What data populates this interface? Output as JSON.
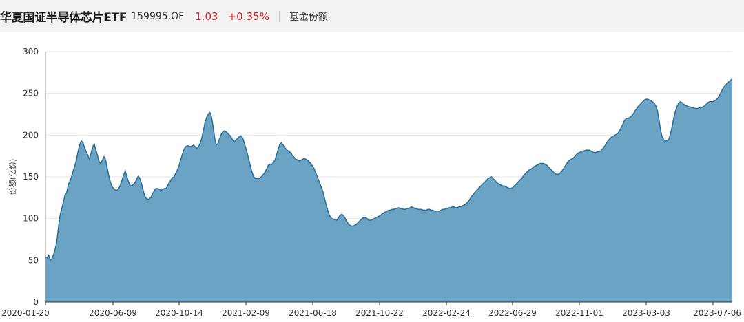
{
  "header": {
    "fund_name": "华夏国证半导体芯片ETF",
    "fund_code": "159995.OF",
    "price": "1.03",
    "change": "+0.35%",
    "metric_label": "基金份额"
  },
  "colors": {
    "area_fill": "#6aa3c4",
    "area_line": "#2d6f96",
    "up": "#d9262e",
    "grid": "#e6e6e6"
  },
  "chart_data": {
    "type": "area",
    "title": "",
    "xlabel": "",
    "ylabel": "份额(亿份)",
    "ylim": [
      0,
      300
    ],
    "yticks": [
      0,
      50,
      100,
      150,
      200,
      250,
      300
    ],
    "grid": true,
    "x_tick_labels": [
      "2020-01-20",
      "2020-06-09",
      "2020-10-14",
      "2021-02-09",
      "2021-06-18",
      "2021-10-22",
      "2022-02-24",
      "2022-06-29",
      "2022-11-01",
      "2023-03-03",
      "2023-07-06"
    ],
    "series": [
      {
        "values": [
          54,
          53,
          56,
          50,
          52,
          57,
          64,
          72,
          90,
          104,
          112,
          120,
          128,
          131,
          140,
          145,
          150,
          157,
          163,
          170,
          180,
          188,
          193,
          191,
          185,
          180,
          176,
          171,
          178,
          186,
          189,
          182,
          175,
          168,
          166,
          170,
          174,
          170,
          160,
          150,
          143,
          138,
          136,
          134,
          134,
          136,
          140,
          146,
          152,
          157,
          150,
          144,
          140,
          139,
          141,
          143,
          147,
          151,
          148,
          142,
          134,
          127,
          124,
          123,
          124,
          126,
          130,
          134,
          136,
          136,
          135,
          134,
          135,
          136,
          136,
          139,
          143,
          146,
          149,
          150,
          154,
          158,
          163,
          170,
          176,
          182,
          186,
          187,
          187,
          186,
          187,
          188,
          186,
          184,
          186,
          190,
          196,
          205,
          215,
          221,
          225,
          227,
          222,
          210,
          196,
          188,
          190,
          196,
          201,
          204,
          205,
          204,
          202,
          200,
          198,
          194,
          192,
          194,
          196,
          198,
          199,
          197,
          192,
          185,
          178,
          170,
          162,
          155,
          150,
          148,
          148,
          148,
          149,
          151,
          153,
          156,
          160,
          164,
          165,
          165,
          167,
          170,
          176,
          183,
          189,
          191,
          188,
          185,
          183,
          181,
          180,
          178,
          175,
          173,
          171,
          170,
          169,
          170,
          171,
          172,
          171,
          170,
          168,
          166,
          163,
          160,
          155,
          150,
          145,
          140,
          135,
          128,
          120,
          113,
          106,
          102,
          100,
          99,
          99,
          98,
          101,
          104,
          105,
          104,
          101,
          97,
          94,
          92,
          91,
          91,
          92,
          93,
          95,
          97,
          99,
          101,
          101,
          101,
          99,
          98,
          98,
          99,
          100,
          101,
          102,
          103,
          104,
          106,
          107,
          108,
          109,
          110,
          110,
          111,
          111,
          112,
          112,
          113,
          112,
          112,
          111,
          111,
          112,
          112,
          113,
          114,
          113,
          112,
          112,
          111,
          111,
          111,
          110,
          110,
          110,
          111,
          111,
          110,
          110,
          109,
          109,
          109,
          109,
          110,
          111,
          111,
          112,
          112,
          113,
          113,
          114,
          114,
          113,
          113,
          114,
          114,
          115,
          116,
          117,
          119,
          121,
          124,
          127,
          129,
          132,
          134,
          136,
          138,
          140,
          142,
          144,
          146,
          148,
          149,
          150,
          148,
          146,
          144,
          142,
          141,
          140,
          139,
          139,
          138,
          137,
          136,
          136,
          137,
          139,
          141,
          143,
          145,
          147,
          149,
          152,
          154,
          156,
          158,
          159,
          160,
          162,
          163,
          164,
          165,
          166,
          166,
          166,
          165,
          164,
          162,
          160,
          158,
          156,
          154,
          153,
          153,
          154,
          156,
          159,
          162,
          165,
          168,
          170,
          171,
          172,
          174,
          176,
          178,
          179,
          180,
          181,
          181,
          182,
          182,
          182,
          181,
          180,
          179,
          179,
          180,
          180,
          181,
          183,
          185,
          188,
          191,
          194,
          196,
          198,
          199,
          200,
          201,
          203,
          206,
          210,
          214,
          218,
          220,
          220,
          221,
          223,
          225,
          228,
          231,
          234,
          236,
          238,
          240,
          242,
          243,
          243,
          242,
          241,
          240,
          238,
          235,
          229,
          218,
          205,
          197,
          194,
          193,
          193,
          195,
          201,
          210,
          220,
          228,
          234,
          238,
          240,
          239,
          237,
          236,
          235,
          234,
          234,
          233,
          233,
          232,
          232,
          232,
          233,
          233,
          234,
          235,
          237,
          239,
          240,
          240,
          240,
          241,
          242,
          244,
          247,
          251,
          255,
          258,
          260,
          262,
          264,
          266,
          267
        ]
      }
    ]
  }
}
